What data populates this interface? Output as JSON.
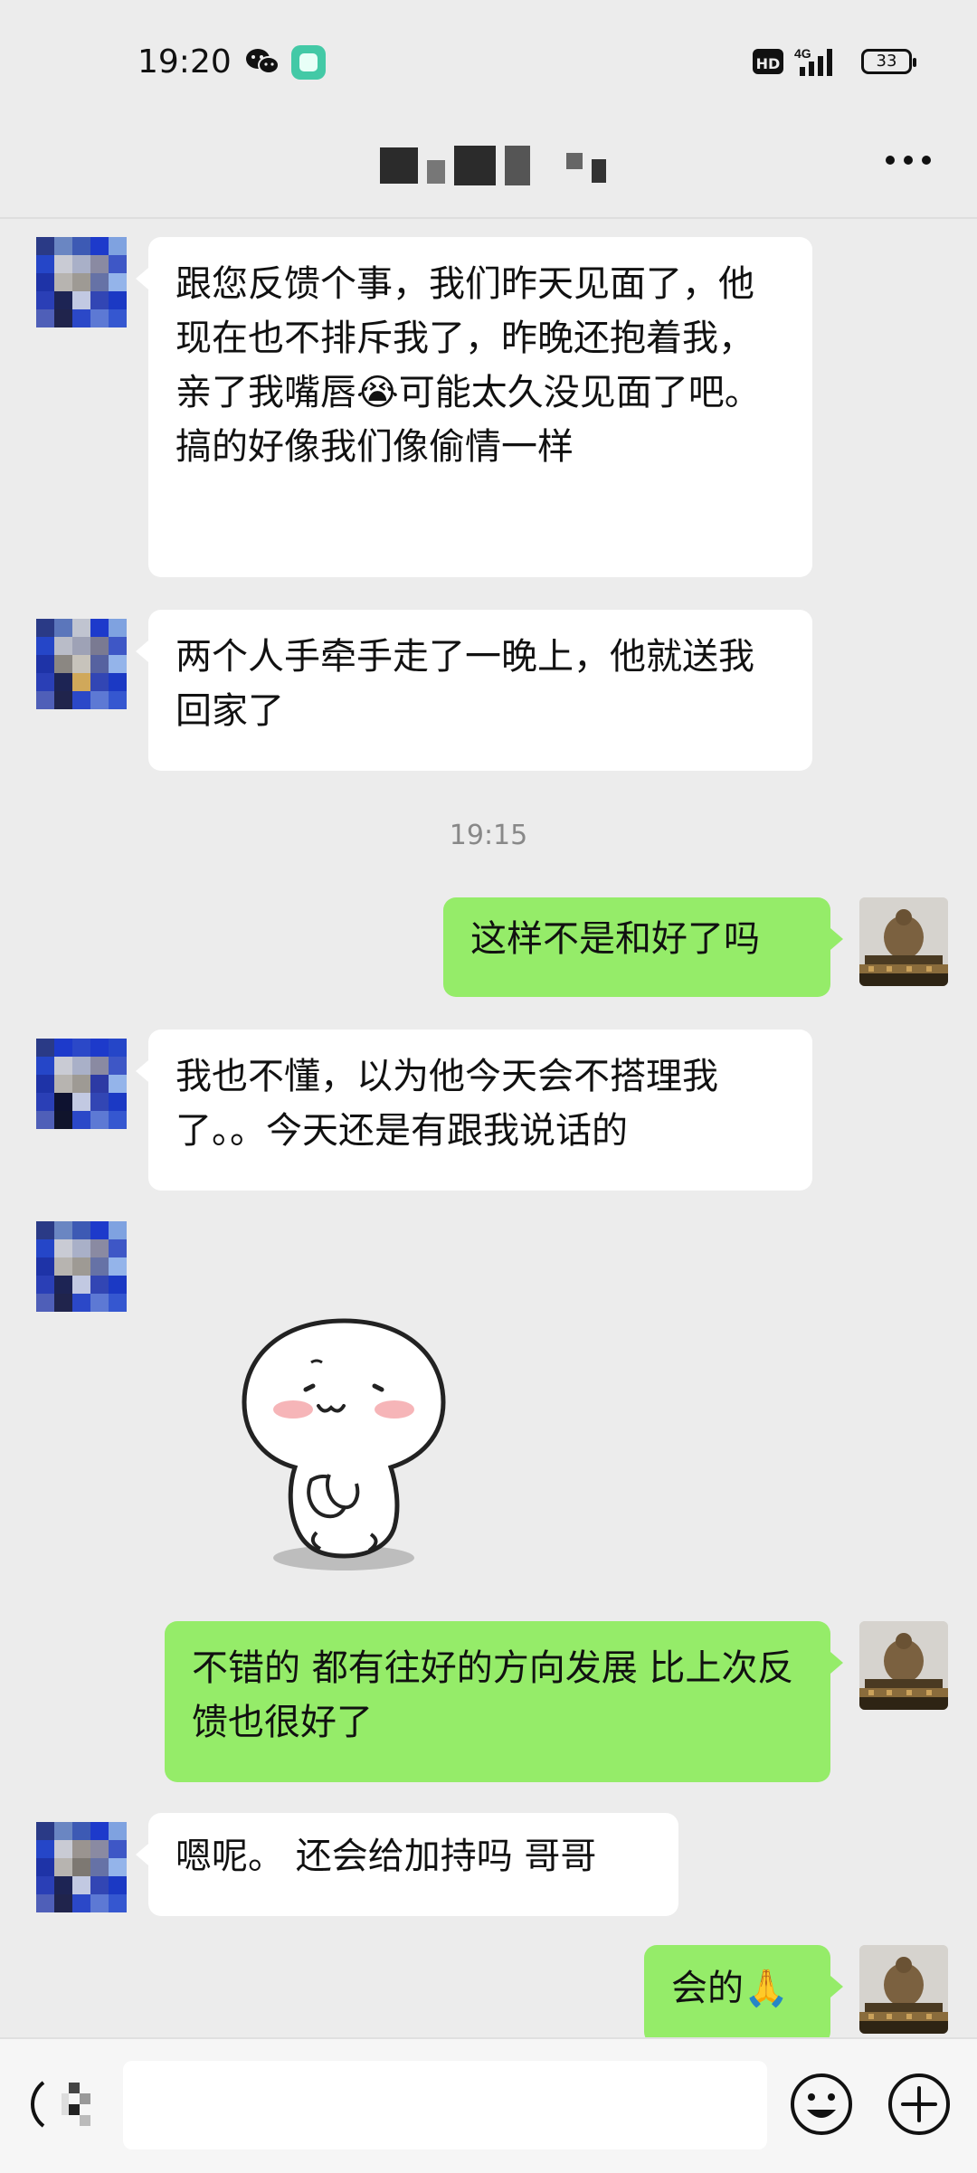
{
  "status_bar": {
    "time": "19:20",
    "network": "4G",
    "battery": "33",
    "icons": [
      "wechat-icon",
      "app-icon",
      "hd-icon",
      "signal-icon",
      "battery-icon"
    ]
  },
  "header": {
    "more_icon": "more-icon"
  },
  "messages": [
    {
      "side": "in",
      "text": "跟您反馈个事，我们昨天见面了，他现在也不排斥我了，昨晚还抱着我，亲了我嘴唇",
      "emoji": "😭",
      "text_after": "可能太久没见面了吧。搞的好像我们像偷情一样"
    },
    {
      "side": "in",
      "text": "两个人手牵手走了一晚上，他就送我回家了"
    },
    {
      "side": "out",
      "text": "这样不是和好了吗"
    },
    {
      "side": "in",
      "text": "我也不懂，以为他今天会不搭理我了。。今天还是有跟我说话的"
    },
    {
      "side": "out",
      "text": "不错的 都有往好的方向发展 比上次反馈也很好了"
    },
    {
      "side": "in",
      "text": "嗯呢。 还会给加持吗 哥哥"
    },
    {
      "side": "out",
      "text": "会的",
      "emoji": "🙏"
    }
  ],
  "timestamp": "19:15",
  "bottom_bar": {
    "input_value": "",
    "icons": [
      "voice-icon",
      "emoji-icon",
      "plus-icon"
    ]
  },
  "colors": {
    "background": "#ececec",
    "bubble_in": "#ffffff",
    "bubble_out": "#95ec69"
  }
}
